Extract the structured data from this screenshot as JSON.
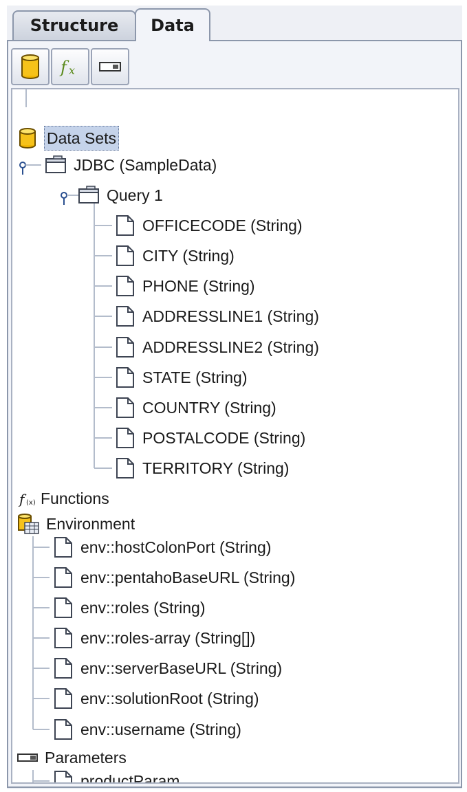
{
  "tabs": [
    {
      "label": "Structure",
      "active": false
    },
    {
      "label": "Data",
      "active": true
    }
  ],
  "toolbar": {
    "buttons": [
      {
        "icon": "database-icon"
      },
      {
        "icon": "function-icon"
      },
      {
        "icon": "parameter-icon"
      }
    ]
  },
  "tree": {
    "data_sets": {
      "label": "Data Sets",
      "jdbc": {
        "label": "JDBC (SampleData)",
        "query": {
          "label": "Query 1",
          "fields": [
            "OFFICECODE (String)",
            "CITY (String)",
            "PHONE (String)",
            "ADDRESSLINE1 (String)",
            "ADDRESSLINE2 (String)",
            "STATE (String)",
            "COUNTRY (String)",
            "POSTALCODE (String)",
            "TERRITORY (String)"
          ]
        }
      }
    },
    "functions": {
      "label": "Functions"
    },
    "environment": {
      "label": "Environment",
      "items": [
        "env::hostColonPort (String)",
        "env::pentahoBaseURL (String)",
        "env::roles (String)",
        "env::roles-array (String[])",
        "env::serverBaseURL (String)",
        "env::solutionRoot (String)",
        "env::username (String)"
      ]
    },
    "parameters": {
      "label": "Parameters",
      "items": [
        "productParam"
      ]
    }
  }
}
